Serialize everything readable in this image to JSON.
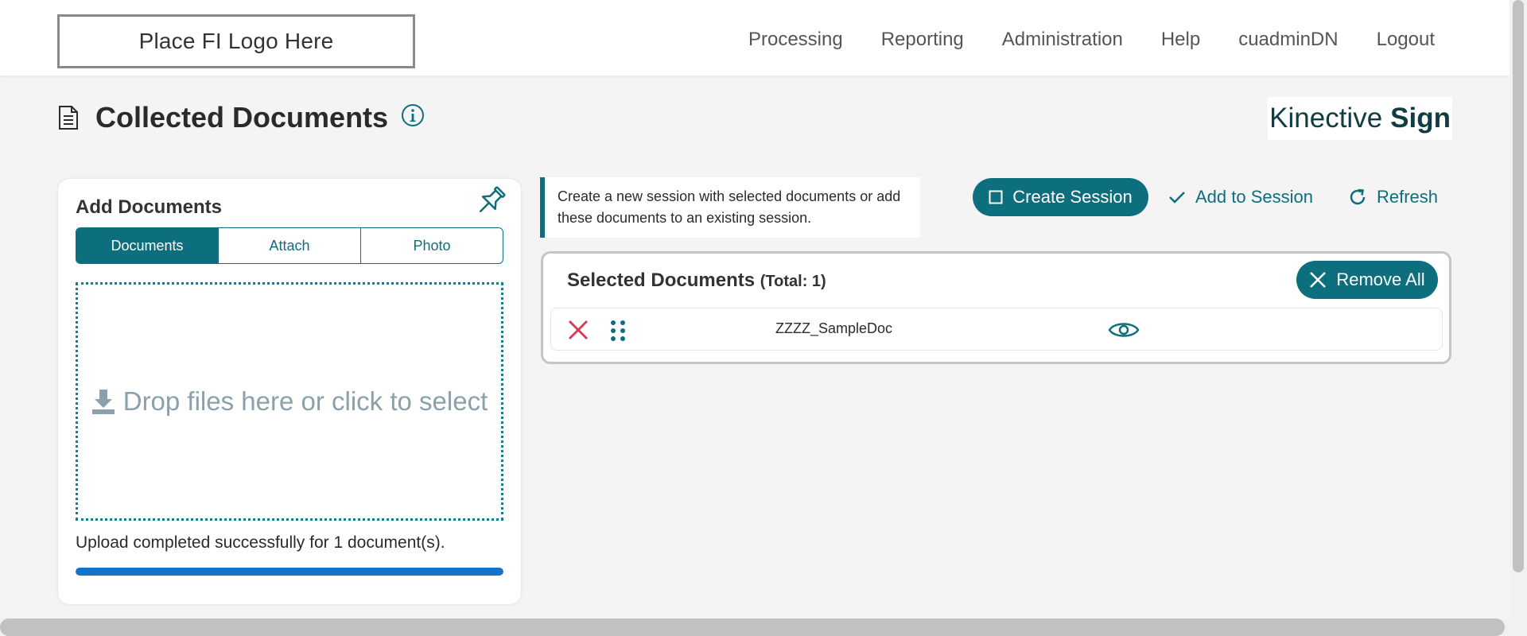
{
  "header": {
    "logo_text": "Place FI Logo Here",
    "nav": [
      "Processing",
      "Reporting",
      "Administration",
      "Help",
      "cuadminDN",
      "Logout"
    ]
  },
  "page": {
    "title": "Collected Documents",
    "brand_light": "Kinective",
    "brand_bold": "Sign"
  },
  "add_documents": {
    "title": "Add Documents",
    "tabs": [
      "Documents",
      "Attach",
      "Photo"
    ],
    "active_tab": "Documents",
    "dropzone_text": "Drop files here or click to select",
    "upload_status": "Upload completed successfully for 1 document(s).",
    "progress_fraction": 1.0
  },
  "session": {
    "note": "Create a new session with selected documents or add these documents to an existing session.",
    "create_label": "Create Session",
    "add_label": "Add to Session",
    "refresh_label": "Refresh"
  },
  "selected": {
    "title": "Selected Documents",
    "total_text": "(Total: 1)",
    "remove_all_label": "Remove All",
    "documents": [
      {
        "name": "ZZZZ_SampleDoc"
      }
    ]
  },
  "colors": {
    "teal": "#0d6e7d",
    "progress": "#1473c8",
    "remove_red": "#d63a4b"
  },
  "icons": {
    "doc": "document-list-icon",
    "info": "info-circle-icon",
    "pin": "pushpin-icon",
    "download": "download-icon",
    "create": "square-outline-icon",
    "check": "checkmark-icon",
    "refresh": "refresh-icon",
    "close": "close-icon",
    "drag": "drag-handle-icon",
    "eye": "eye-icon"
  }
}
